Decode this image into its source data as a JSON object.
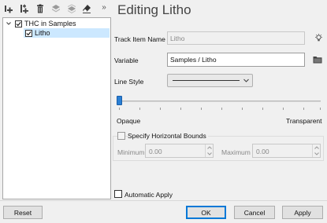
{
  "toolbar": {
    "icons": [
      "add-track-icon",
      "add-multiple-icon",
      "delete-icon",
      "layer-up-icon",
      "layer-down-icon",
      "eraser-icon"
    ],
    "overflow": "»"
  },
  "tree": {
    "items": [
      {
        "label": "THC in Samples",
        "checked": true,
        "expanded": true
      },
      {
        "label": "Litho",
        "checked": true,
        "selected": true
      }
    ]
  },
  "panel": {
    "title": "Editing Litho",
    "track_item_name_label": "Track Item Name",
    "track_item_name_value": "Litho",
    "variable_label": "Variable",
    "variable_value": "Samples / Litho",
    "line_style_label": "Line Style",
    "opacity": {
      "value": 0,
      "min_label": "Opaque",
      "max_label": "Transparent"
    },
    "horizontal_bounds": {
      "label": "Specify Horizontal Bounds",
      "checked": false,
      "minimum_label": "Minimum",
      "minimum_value": "0.00",
      "maximum_label": "Maximum",
      "maximum_value": "0.00"
    },
    "automatic_apply_label": "Automatic Apply",
    "automatic_apply_checked": false
  },
  "buttons": {
    "reset": "Reset",
    "ok": "OK",
    "cancel": "Cancel",
    "apply": "Apply"
  }
}
